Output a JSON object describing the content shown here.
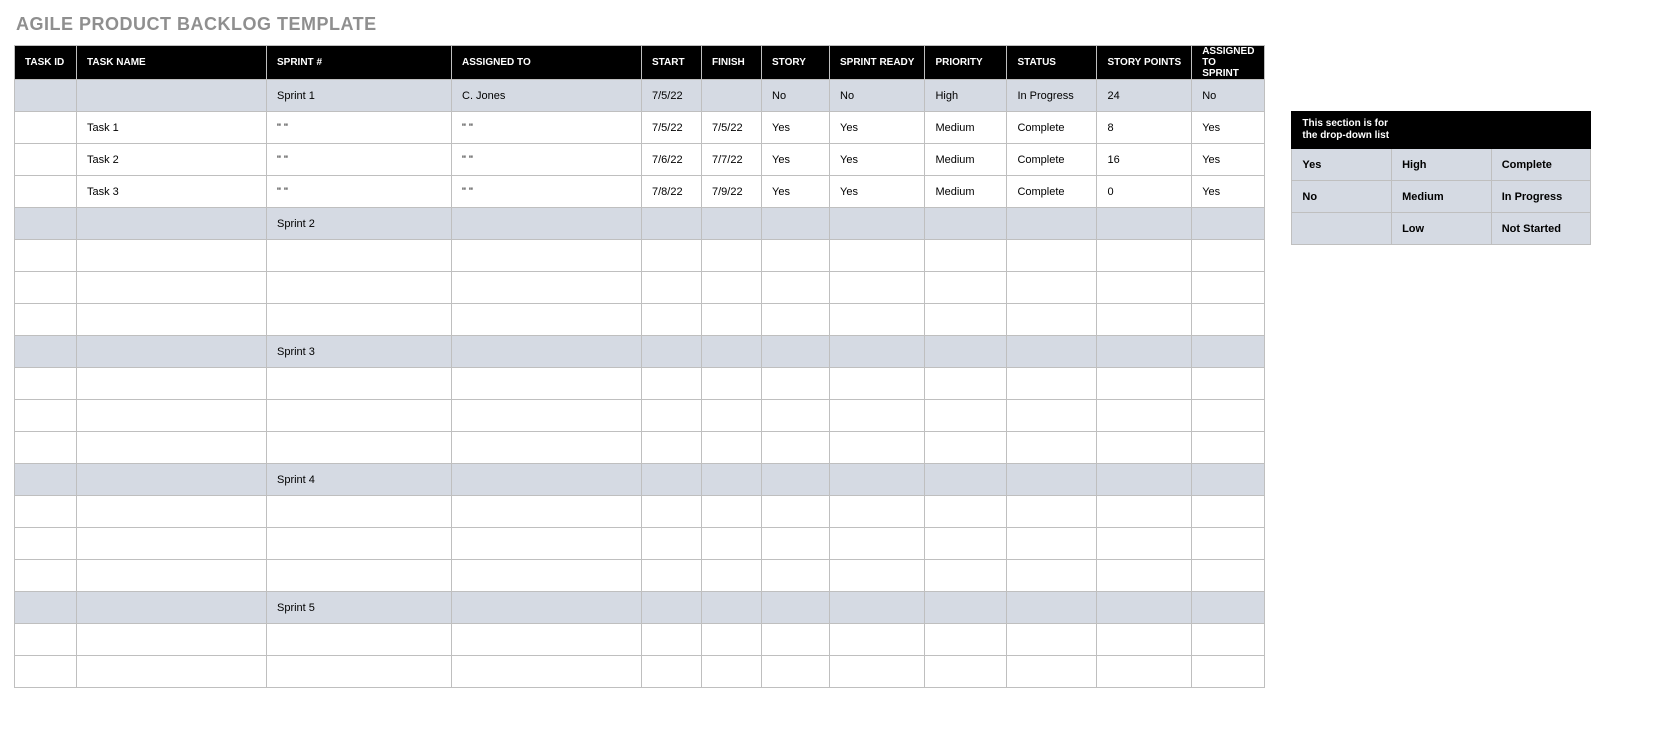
{
  "title": "AGILE PRODUCT BACKLOG TEMPLATE",
  "columns": {
    "task_id": "TASK ID",
    "task_name": "TASK NAME",
    "sprint": "SPRINT #",
    "assigned_to": "ASSIGNED TO",
    "start": "START",
    "finish": "FINISH",
    "story": "STORY",
    "sprint_ready": "SPRINT READY",
    "priority": "PRIORITY",
    "status": "STATUS",
    "story_points": "STORY POINTS",
    "assigned_to_sprint": "ASSIGNED TO SPRINT"
  },
  "rows": [
    {
      "type": "sprint",
      "task_id": "",
      "task_name": "",
      "sprint": "Sprint 1",
      "assigned_to": "C. Jones",
      "start": "7/5/22",
      "finish": "",
      "story": "No",
      "sprint_ready": "No",
      "priority": "High",
      "status": "In Progress",
      "story_points": "24",
      "assigned_to_sprint": "No"
    },
    {
      "type": "task",
      "task_id": "",
      "task_name": "Task 1",
      "sprint": "\" \"",
      "assigned_to": "\" \"",
      "start": "7/5/22",
      "finish": "7/5/22",
      "story": "Yes",
      "sprint_ready": "Yes",
      "priority": "Medium",
      "status": "Complete",
      "story_points": "8",
      "assigned_to_sprint": "Yes"
    },
    {
      "type": "task",
      "task_id": "",
      "task_name": "Task 2",
      "sprint": "\" \"",
      "assigned_to": "\" \"",
      "start": "7/6/22",
      "finish": "7/7/22",
      "story": "Yes",
      "sprint_ready": "Yes",
      "priority": "Medium",
      "status": "Complete",
      "story_points": "16",
      "assigned_to_sprint": "Yes"
    },
    {
      "type": "task",
      "task_id": "",
      "task_name": "Task 3",
      "sprint": "\" \"",
      "assigned_to": "\" \"",
      "start": "7/8/22",
      "finish": "7/9/22",
      "story": "Yes",
      "sprint_ready": "Yes",
      "priority": "Medium",
      "status": "Complete",
      "story_points": "0",
      "assigned_to_sprint": "Yes"
    },
    {
      "type": "sprint",
      "task_id": "",
      "task_name": "",
      "sprint": "Sprint 2",
      "assigned_to": "",
      "start": "",
      "finish": "",
      "story": "",
      "sprint_ready": "",
      "priority": "",
      "status": "",
      "story_points": "",
      "assigned_to_sprint": ""
    },
    {
      "type": "task",
      "task_id": "",
      "task_name": "",
      "sprint": "",
      "assigned_to": "",
      "start": "",
      "finish": "",
      "story": "",
      "sprint_ready": "",
      "priority": "",
      "status": "",
      "story_points": "",
      "assigned_to_sprint": ""
    },
    {
      "type": "task",
      "task_id": "",
      "task_name": "",
      "sprint": "",
      "assigned_to": "",
      "start": "",
      "finish": "",
      "story": "",
      "sprint_ready": "",
      "priority": "",
      "status": "",
      "story_points": "",
      "assigned_to_sprint": ""
    },
    {
      "type": "task",
      "task_id": "",
      "task_name": "",
      "sprint": "",
      "assigned_to": "",
      "start": "",
      "finish": "",
      "story": "",
      "sprint_ready": "",
      "priority": "",
      "status": "",
      "story_points": "",
      "assigned_to_sprint": ""
    },
    {
      "type": "sprint",
      "task_id": "",
      "task_name": "",
      "sprint": "Sprint 3",
      "assigned_to": "",
      "start": "",
      "finish": "",
      "story": "",
      "sprint_ready": "",
      "priority": "",
      "status": "",
      "story_points": "",
      "assigned_to_sprint": ""
    },
    {
      "type": "task",
      "task_id": "",
      "task_name": "",
      "sprint": "",
      "assigned_to": "",
      "start": "",
      "finish": "",
      "story": "",
      "sprint_ready": "",
      "priority": "",
      "status": "",
      "story_points": "",
      "assigned_to_sprint": ""
    },
    {
      "type": "task",
      "task_id": "",
      "task_name": "",
      "sprint": "",
      "assigned_to": "",
      "start": "",
      "finish": "",
      "story": "",
      "sprint_ready": "",
      "priority": "",
      "status": "",
      "story_points": "",
      "assigned_to_sprint": ""
    },
    {
      "type": "task",
      "task_id": "",
      "task_name": "",
      "sprint": "",
      "assigned_to": "",
      "start": "",
      "finish": "",
      "story": "",
      "sprint_ready": "",
      "priority": "",
      "status": "",
      "story_points": "",
      "assigned_to_sprint": ""
    },
    {
      "type": "sprint",
      "task_id": "",
      "task_name": "",
      "sprint": "Sprint 4",
      "assigned_to": "",
      "start": "",
      "finish": "",
      "story": "",
      "sprint_ready": "",
      "priority": "",
      "status": "",
      "story_points": "",
      "assigned_to_sprint": ""
    },
    {
      "type": "task",
      "task_id": "",
      "task_name": "",
      "sprint": "",
      "assigned_to": "",
      "start": "",
      "finish": "",
      "story": "",
      "sprint_ready": "",
      "priority": "",
      "status": "",
      "story_points": "",
      "assigned_to_sprint": ""
    },
    {
      "type": "task",
      "task_id": "",
      "task_name": "",
      "sprint": "",
      "assigned_to": "",
      "start": "",
      "finish": "",
      "story": "",
      "sprint_ready": "",
      "priority": "",
      "status": "",
      "story_points": "",
      "assigned_to_sprint": ""
    },
    {
      "type": "task",
      "task_id": "",
      "task_name": "",
      "sprint": "",
      "assigned_to": "",
      "start": "",
      "finish": "",
      "story": "",
      "sprint_ready": "",
      "priority": "",
      "status": "",
      "story_points": "",
      "assigned_to_sprint": ""
    },
    {
      "type": "sprint",
      "task_id": "",
      "task_name": "",
      "sprint": "Sprint 5",
      "assigned_to": "",
      "start": "",
      "finish": "",
      "story": "",
      "sprint_ready": "",
      "priority": "",
      "status": "",
      "story_points": "",
      "assigned_to_sprint": ""
    },
    {
      "type": "task",
      "task_id": "",
      "task_name": "",
      "sprint": "",
      "assigned_to": "",
      "start": "",
      "finish": "",
      "story": "",
      "sprint_ready": "",
      "priority": "",
      "status": "",
      "story_points": "",
      "assigned_to_sprint": ""
    },
    {
      "type": "task",
      "task_id": "",
      "task_name": "",
      "sprint": "",
      "assigned_to": "",
      "start": "",
      "finish": "",
      "story": "",
      "sprint_ready": "",
      "priority": "",
      "status": "",
      "story_points": "",
      "assigned_to_sprint": ""
    }
  ],
  "dropdown": {
    "heading": "This section is for\nthe drop-down list",
    "col1": [
      "Yes",
      "No",
      ""
    ],
    "col2": [
      "High",
      "Medium",
      "Low"
    ],
    "col3": [
      "Complete",
      "In Progress",
      "Not Started"
    ]
  }
}
